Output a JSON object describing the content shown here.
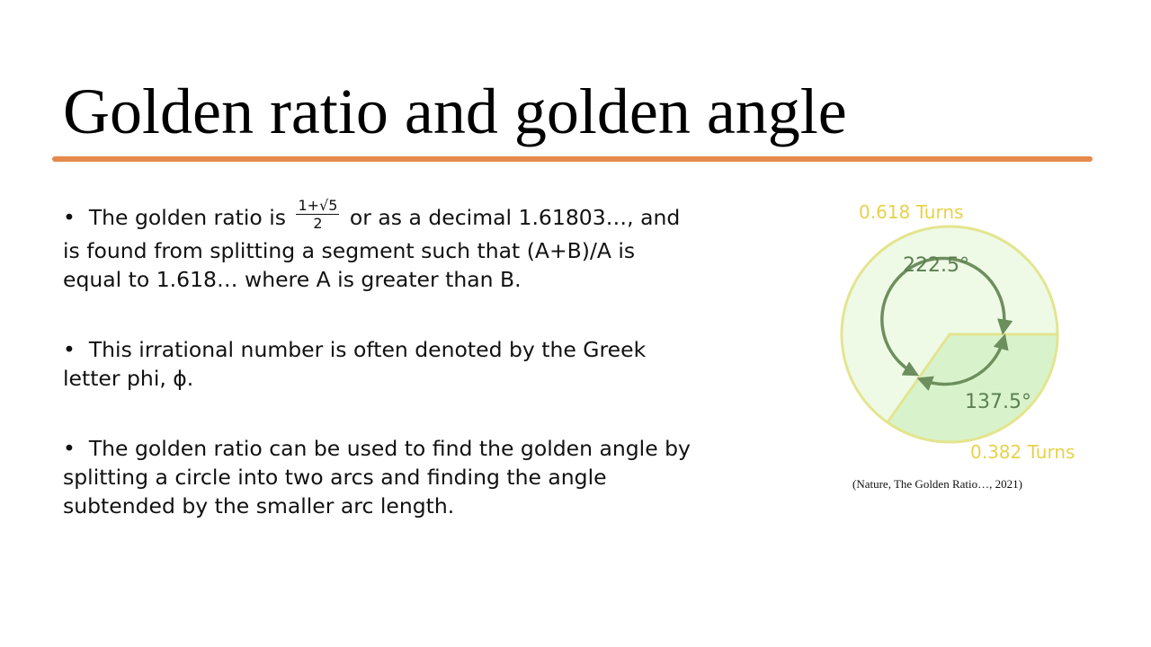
{
  "slide": {
    "title": "Golden ratio and golden angle",
    "accent_color": "#e58a4c"
  },
  "bullets": [
    {
      "prefix": "The golden ratio is ",
      "fraction": {
        "numerator": "1+√5",
        "denominator": "2"
      },
      "suffix": " or as a decimal 1.61803…, and is found from splitting a segment such that (A+B)/A is equal to 1.618… where A is greater than B."
    },
    {
      "text": "This irrational number is often denoted by the Greek letter phi, ϕ."
    },
    {
      "text": "The golden ratio can be used to find the golden angle by splitting a circle into two arcs and finding the angle subtended by the smaller arc length."
    }
  ],
  "figure": {
    "large_turns_label": "0.618 Turns",
    "large_angle_label": "222.5°",
    "small_angle_label": "137.5°",
    "small_turns_label": "0.382 Turns",
    "label_color": "#e6d24a",
    "angle_text_color": "#5c7f52"
  },
  "caption": "(Nature, The Golden Ratio…, 2021)"
}
